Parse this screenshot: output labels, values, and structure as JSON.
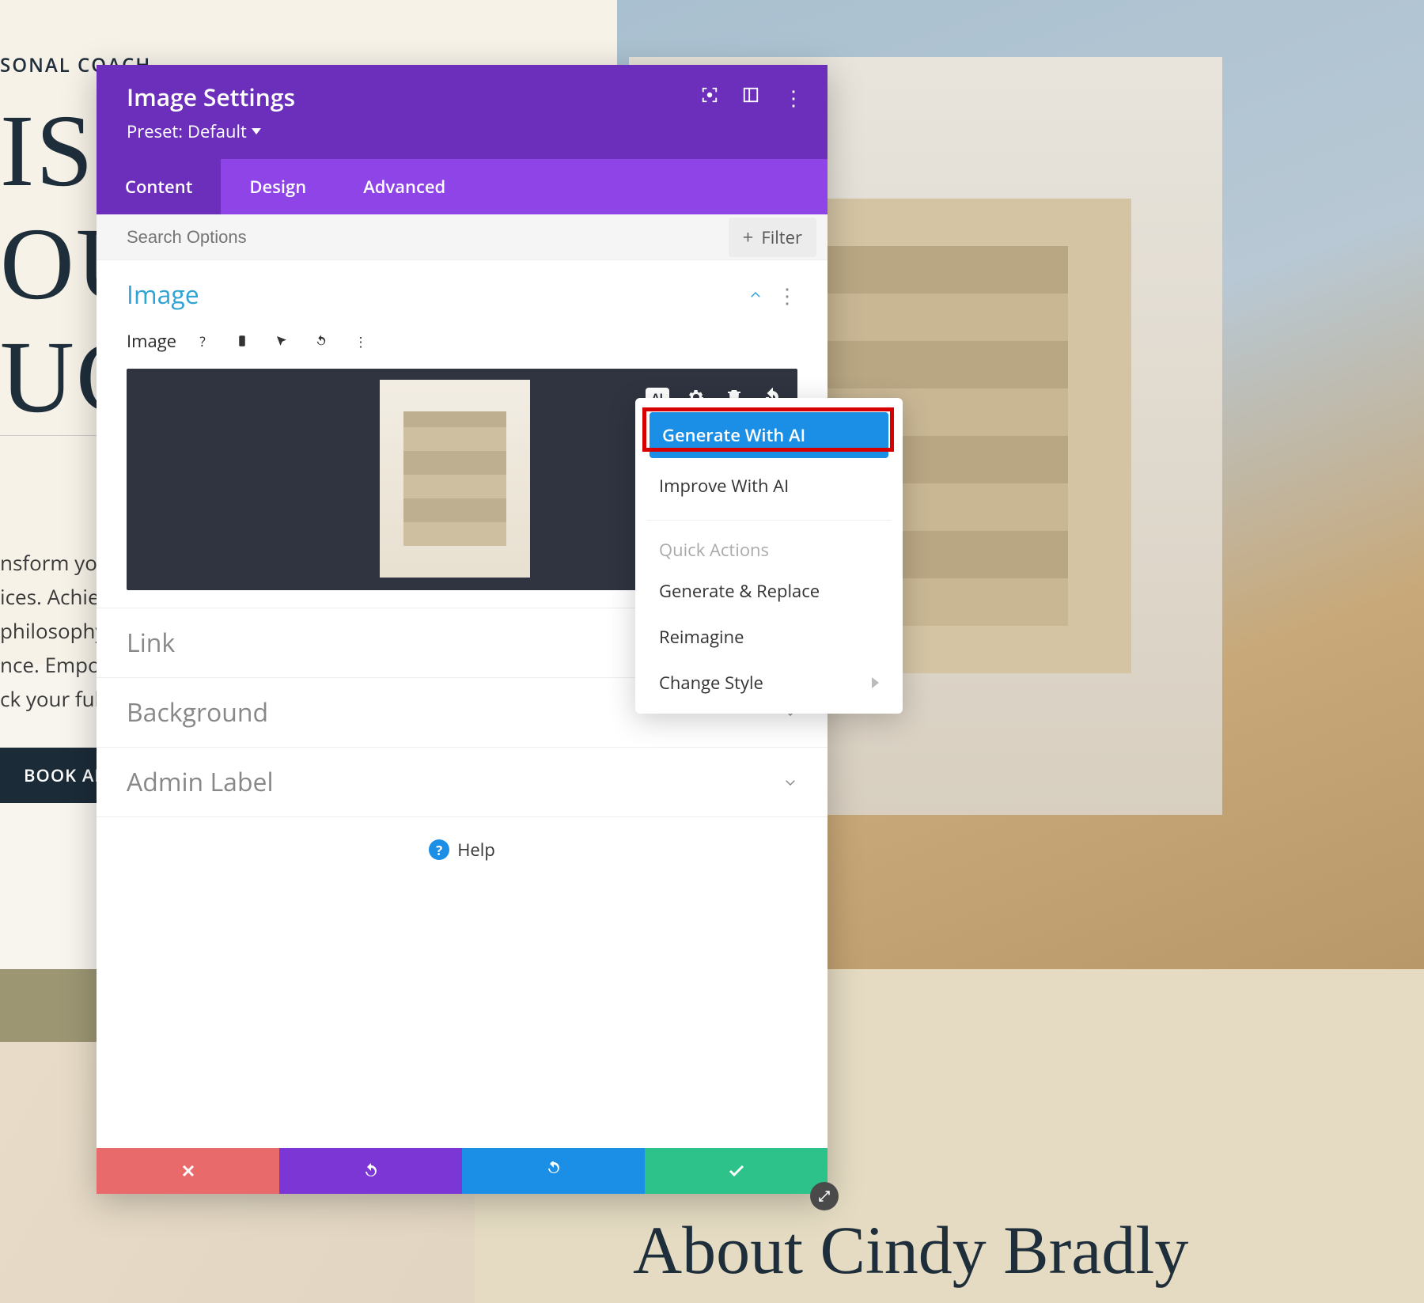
{
  "page": {
    "eyebrow": "SONAL COACH",
    "hero_line1": "ISC",
    "hero_line2": "OU",
    "hero_line3": "UC",
    "body": "nsform your\nices. Achiev\n philosophy\nnce. Empov\nck your ful",
    "cta": "BOOK AN APP",
    "about_name": "About Cindy Bradly"
  },
  "modal": {
    "title": "Image Settings",
    "preset_label": "Preset:",
    "preset_value": "Default",
    "tabs": [
      "Content",
      "Design",
      "Advanced"
    ],
    "active_tab": "Content",
    "search_placeholder": "Search Options",
    "filter_label": "Filter",
    "sections": {
      "image": {
        "title": "Image",
        "field_label": "Image"
      },
      "link": {
        "title": "Link"
      },
      "background": {
        "title": "Background"
      },
      "admin_label": {
        "title": "Admin Label"
      }
    },
    "help_label": "Help",
    "flyout": {
      "primary": "Generate With AI",
      "improve": "Improve With AI",
      "quick_heading": "Quick Actions",
      "generate_replace": "Generate & Replace",
      "reimagine": "Reimagine",
      "change_style": "Change Style"
    }
  }
}
